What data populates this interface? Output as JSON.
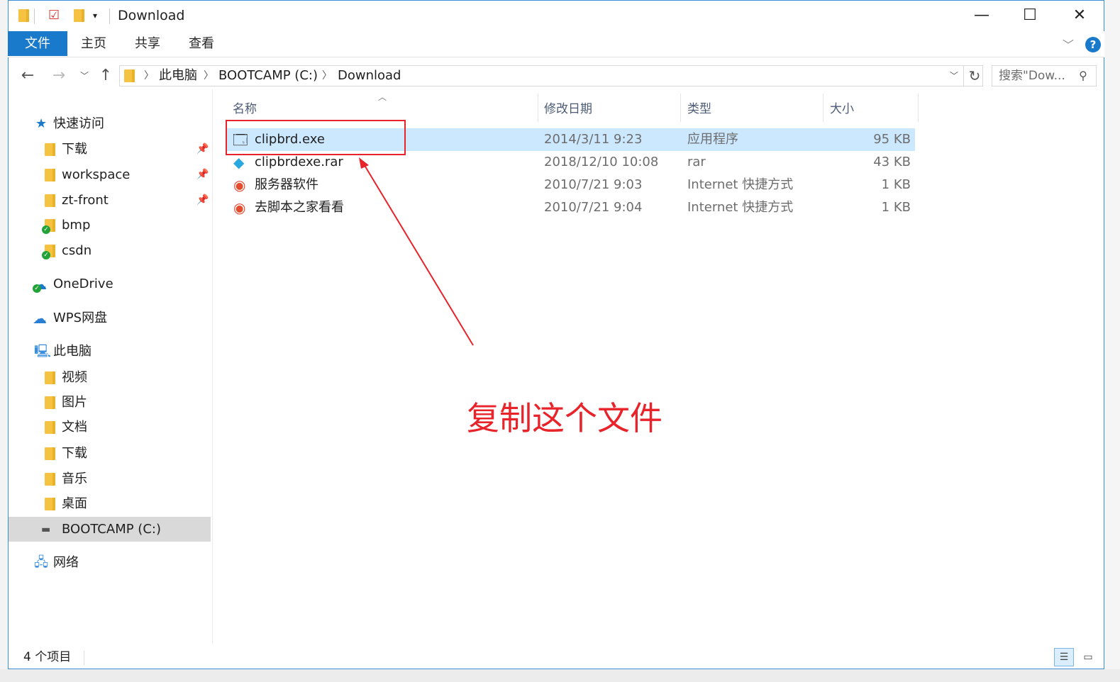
{
  "window": {
    "title": "Download",
    "controls": {
      "minimize": "—",
      "maximize": "☐",
      "close": "✕"
    }
  },
  "ribbon": {
    "tabs": [
      "文件",
      "主页",
      "共享",
      "查看"
    ],
    "help": "?"
  },
  "address": {
    "crumbs": [
      "此电脑",
      "BOOTCAMP (C:)",
      "Download"
    ],
    "search_placeholder": "搜索\"Dow..."
  },
  "sidebar": {
    "quick_access": "快速访问",
    "quick_items": [
      "下载",
      "workspace",
      "zt-front",
      "bmp",
      "csdn"
    ],
    "onedrive": "OneDrive",
    "wps": "WPS网盘",
    "this_pc": "此电脑",
    "pc_items": [
      "视频",
      "图片",
      "文档",
      "下载",
      "音乐",
      "桌面",
      "BOOTCAMP (C:)"
    ],
    "network": "网络"
  },
  "files": {
    "columns": [
      "名称",
      "修改日期",
      "类型",
      "大小"
    ],
    "rows": [
      {
        "name": "clipbrd.exe",
        "date": "2014/3/11 9:23",
        "type": "应用程序",
        "size": "95 KB"
      },
      {
        "name": "clipbrdexe.rar",
        "date": "2018/12/10 10:08",
        "type": "rar",
        "size": "43 KB"
      },
      {
        "name": "服务器软件",
        "date": "2010/7/21 9:03",
        "type": "Internet 快捷方式",
        "size": "1 KB"
      },
      {
        "name": "去脚本之家看看",
        "date": "2010/7/21 9:04",
        "type": "Internet 快捷方式",
        "size": "1 KB"
      }
    ]
  },
  "status": {
    "count": "4 个项目"
  },
  "annotation": {
    "text": "复制这个文件"
  },
  "colors": {
    "accent": "#1979ca",
    "selection": "#cce8ff",
    "annotation": "#e8232a"
  }
}
